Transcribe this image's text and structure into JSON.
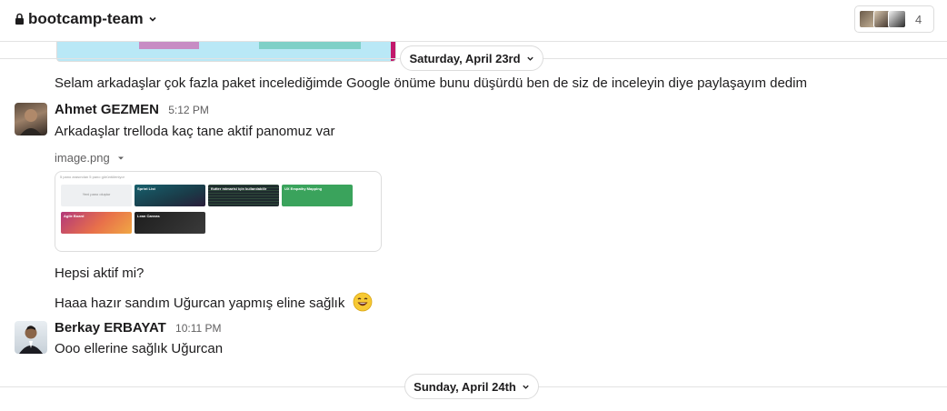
{
  "header": {
    "channel_name": "bootcamp-team",
    "member_count": "4"
  },
  "dates": {
    "first": "Saturday, April 23rd",
    "second": "Sunday, April 24th"
  },
  "messages": [
    {
      "text": "Selam arkadaşlar çok fazla paket incelediğimde Google önüme bunu düşürdü ben de siz de inceleyin diye paylaşayım dedim"
    },
    {
      "sender": "Ahmet GEZMEN",
      "time": "5:12 PM",
      "text": "Arkadaşlar trelloda kaç tane aktif panomuz var",
      "attachment": {
        "filename": "image.png",
        "header": "5 pano arasından 5 pano görüntüleniyor",
        "boards": [
          {
            "title": "Yeni pano oluştur",
            "color": "#f1f2f4"
          },
          {
            "title": "Sprint List",
            "color": "#1b4a5a"
          },
          {
            "title": "flutter mimarisi için kullanılabilir",
            "color": "#1e2a2e"
          },
          {
            "title": "UX Empathy Mapping",
            "color": "#3aa35c"
          },
          {
            "title": "Agile Board",
            "color": "#c0476a"
          },
          {
            "title": "Lean Canvas",
            "color": "#2a2a2a"
          }
        ]
      }
    },
    {
      "text": "Hepsi aktif mi?"
    },
    {
      "text": "Haaa hazır sandım Uğurcan yapmış eline sağlık",
      "emoji": "smile"
    },
    {
      "sender": "Berkay ERBAYAT",
      "time": "10:11 PM",
      "text": "Ooo ellerine sağlık Uğurcan"
    }
  ]
}
